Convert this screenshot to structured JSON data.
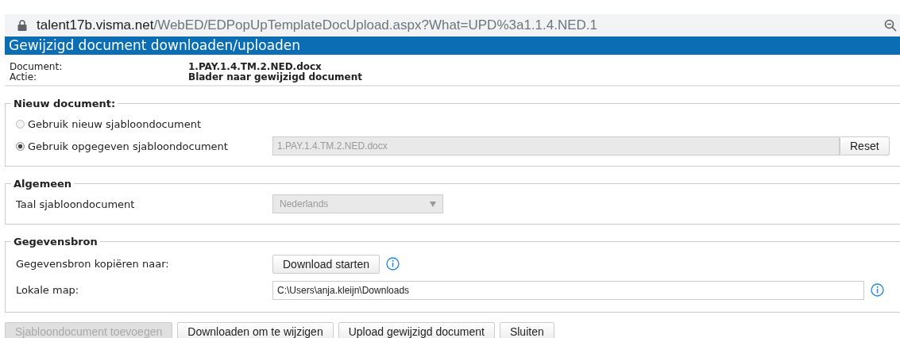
{
  "address_bar": {
    "domain": "talent17b.visma.net",
    "path": "/WebED/EDPopUpTemplateDocUpload.aspx?What=UPD%3a1.1.4.NED.1"
  },
  "dialog_title": "Gewijzigd document downloaden/uploaden",
  "info": [
    {
      "label": "Document:",
      "value": "1.PAY.1.4.TM.2.NED.docx"
    },
    {
      "label": "Actie:",
      "value": "Blader naar gewijzigd document"
    }
  ],
  "sections": [
    {
      "title": "Nieuw document:",
      "rows": [
        {
          "kind": "radio",
          "label": "Gebruik nieuw sjabloondocument",
          "selected": false
        },
        {
          "kind": "radio",
          "label": "Gebruik opgegeven sjabloondocument",
          "selected": true,
          "value": "1.PAY.1.4.TM.2.NED.docx",
          "disabled": true,
          "button": "Reset"
        }
      ]
    },
    {
      "title": "Algemeen",
      "rows": [
        {
          "kind": "select",
          "label": "Taal sjabloondocument",
          "value": "Nederlands",
          "disabled": true
        }
      ]
    },
    {
      "title": "Gegevensbron",
      "rows": [
        {
          "kind": "button",
          "label": "Gegevensbron kopiëren naar:",
          "button": "Download starten",
          "info": true
        },
        {
          "kind": "input",
          "label": "Lokale map:",
          "value": "C:\\Users\\anja.kleijn\\Downloads",
          "disabled": false,
          "info": true
        }
      ]
    }
  ],
  "footer_buttons": [
    {
      "label": "Sjabloondocument toevoegen",
      "disabled": true
    },
    {
      "label": "Downloaden om te wijzigen",
      "disabled": false
    },
    {
      "label": "Upload gewijzigd document",
      "disabled": false
    },
    {
      "label": "Sluiten",
      "disabled": false
    }
  ]
}
